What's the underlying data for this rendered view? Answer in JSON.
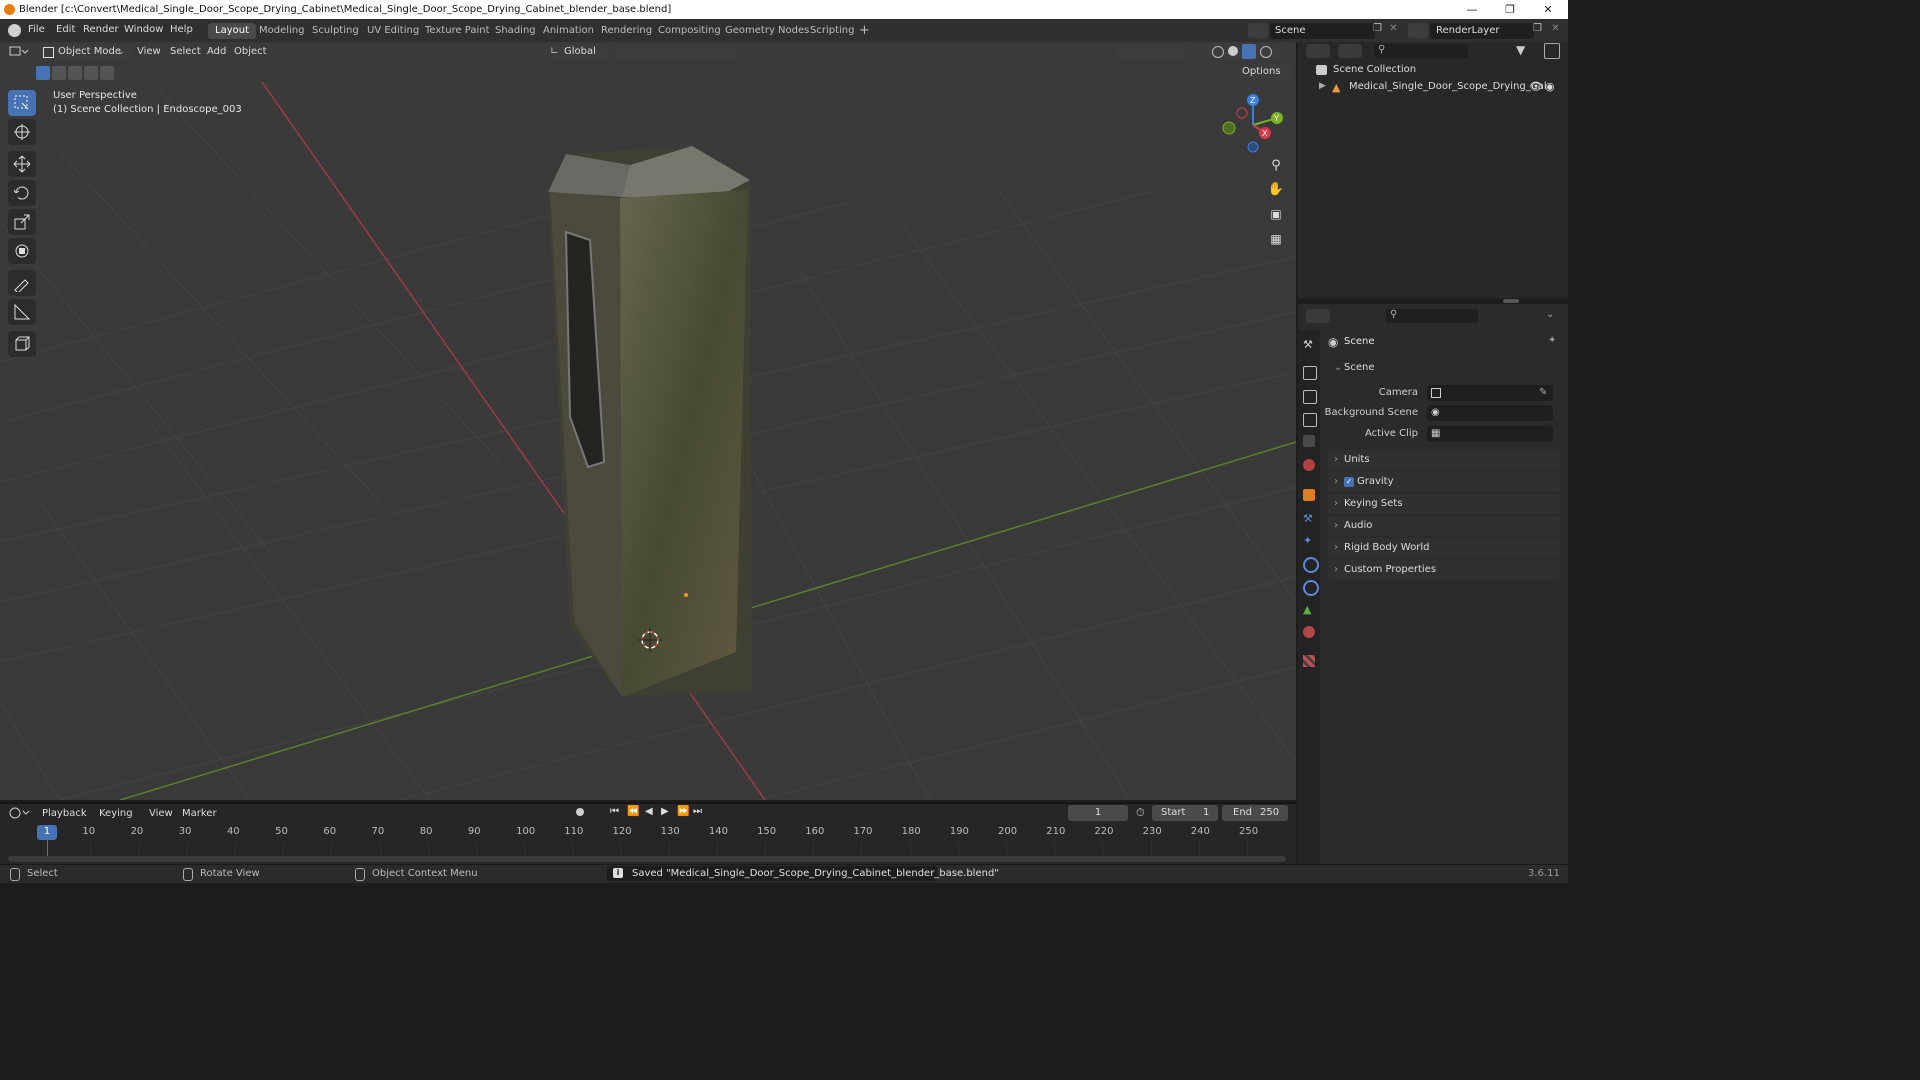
{
  "window": {
    "title": "Blender [c:\\Convert\\Medical_Single_Door_Scope_Drying_Cabinet\\Medical_Single_Door_Scope_Drying_Cabinet_blender_base.blend]"
  },
  "menu": [
    "File",
    "Edit",
    "Render",
    "Window",
    "Help"
  ],
  "workspaces": [
    "Layout",
    "Modeling",
    "Sculpting",
    "UV Editing",
    "Texture Paint",
    "Shading",
    "Animation",
    "Rendering",
    "Compositing",
    "Geometry Nodes",
    "Scripting"
  ],
  "active_workspace": "Layout",
  "scene_name": "Scene",
  "view_layer": "RenderLayer",
  "viewport_header": {
    "mode": "Object Mode",
    "view": "View",
    "select": "Select",
    "add": "Add",
    "object": "Object",
    "orientation": "Global",
    "options": "Options"
  },
  "viewport": {
    "perspective": "User Perspective",
    "collection_info": "(1) Scene Collection | Endoscope_003"
  },
  "gizmo": {
    "z": "Z",
    "y": "Y",
    "x": "X"
  },
  "outliner": {
    "root": "Scene Collection",
    "item": "Medical_Single_Door_Scope_Drying_Cal"
  },
  "properties": {
    "header": "Scene",
    "panel": "Scene",
    "camera_label": "Camera",
    "background_scene_label": "Background Scene",
    "active_clip_label": "Active Clip",
    "sections": [
      "Units",
      "Gravity",
      "Keying Sets",
      "Audio",
      "Rigid Body World",
      "Custom Properties"
    ],
    "gravity_checked": true
  },
  "timeline": {
    "playback": "Playback",
    "keying": "Keying",
    "view": "View",
    "marker": "Marker",
    "current_frame": "1",
    "start_label": "Start",
    "start": "1",
    "end_label": "End",
    "end": "250",
    "ticks": [
      "1",
      "10",
      "20",
      "30",
      "40",
      "50",
      "60",
      "70",
      "80",
      "90",
      "100",
      "110",
      "120",
      "130",
      "140",
      "150",
      "160",
      "170",
      "180",
      "190",
      "200",
      "210",
      "220",
      "230",
      "240",
      "250"
    ]
  },
  "statusbar": {
    "select": "Select",
    "rotate": "Rotate View",
    "context": "Object Context Menu",
    "message": "Saved \"Medical_Single_Door_Scope_Drying_Cabinet_blender_base.blend\"",
    "version": "3.6.11"
  },
  "colors": {
    "accent": "#4772b3",
    "x_axis": "#d63b48",
    "y_axis": "#78b324",
    "z_axis": "#3d7fe0"
  }
}
